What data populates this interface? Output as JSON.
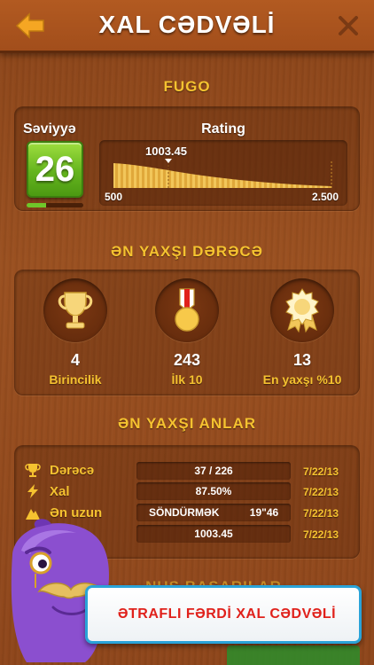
{
  "header": {
    "title": "XAL CƏDVƏLİ",
    "back_icon": "back-arrow-icon",
    "close_icon": "close-icon"
  },
  "player": {
    "name": "FUGO",
    "level_label": "Səviyyə",
    "level": "26",
    "level_progress": 0.35
  },
  "rating": {
    "label": "Rating",
    "current": "1003.45",
    "min": "500",
    "max": "2.500"
  },
  "best_ranks": {
    "title": "ƏN YAXŞI DƏRƏCƏ",
    "items": [
      {
        "icon": "trophy-icon",
        "value": "4",
        "label": "Birincilik"
      },
      {
        "icon": "medal-icon",
        "value": "243",
        "label": "İlk 10"
      },
      {
        "icon": "rosette-icon",
        "value": "13",
        "label": "En yaxşı %10"
      }
    ]
  },
  "best_moments": {
    "title": "ƏN YAXŞI ANLAR",
    "rows": [
      {
        "icon": "trophy-icon",
        "label": "Dərəcə",
        "value": "37 / 226",
        "date": "7/22/13"
      },
      {
        "icon": "lightning-icon",
        "label": "Xal",
        "value": "87.50%",
        "date": "7/22/13"
      },
      {
        "icon": "mountain-icon",
        "label": "Ən uzun",
        "value_left": "SÖNDÜRMƏK",
        "value_right": "19\"46",
        "date": "7/22/13"
      },
      {
        "icon": "",
        "label": "",
        "value": "1003.45",
        "date": "7/22/13"
      }
    ]
  },
  "partial_section_title": "NUS BAŞARILAR",
  "cta": {
    "label": "ƏTRAFLI FƏRDİ XAL CƏDVƏLİ"
  },
  "colors": {
    "accent_gold": "#f5c230",
    "cta_text": "#e0211b",
    "cta_border": "#2aa3d8",
    "level_green": "#64b41e"
  }
}
